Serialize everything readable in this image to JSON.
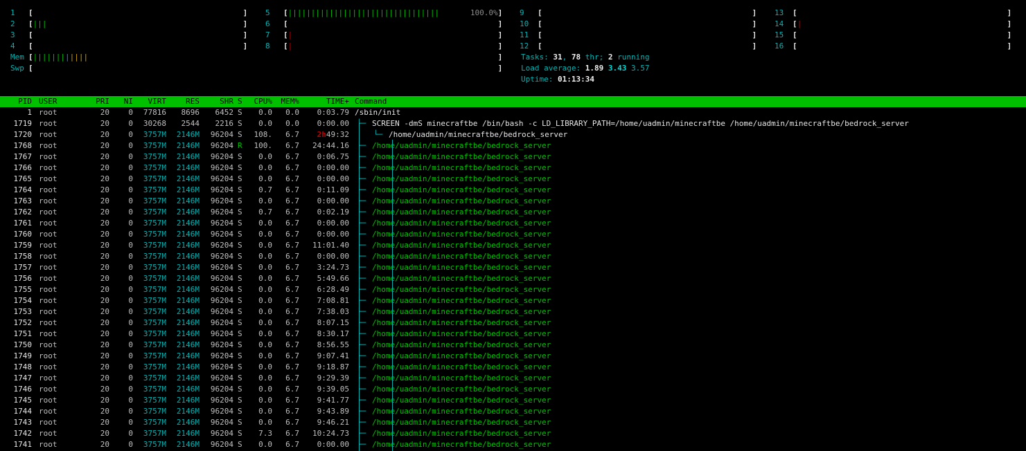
{
  "cpu_meters": [
    {
      "label": "1",
      "segments": []
    },
    {
      "label": "2",
      "segments": [
        {
          "c": "g",
          "t": "|||"
        }
      ]
    },
    {
      "label": "3",
      "segments": []
    },
    {
      "label": "4",
      "segments": []
    },
    {
      "label": "5",
      "segments": [
        {
          "c": "g",
          "t": "|||||||||||||||||||||||||||||||||"
        }
      ],
      "percent": "100.0%"
    },
    {
      "label": "6",
      "segments": []
    },
    {
      "label": "7",
      "segments": [
        {
          "c": "r",
          "t": "|"
        }
      ]
    },
    {
      "label": "8",
      "segments": [
        {
          "c": "r",
          "t": "|"
        }
      ]
    },
    {
      "label": "9",
      "segments": []
    },
    {
      "label": "10",
      "segments": []
    },
    {
      "label": "11",
      "segments": []
    },
    {
      "label": "12",
      "segments": []
    },
    {
      "label": "13",
      "segments": []
    },
    {
      "label": "14",
      "segments": [
        {
          "c": "r",
          "t": "|"
        }
      ]
    },
    {
      "label": "15",
      "segments": []
    },
    {
      "label": "16",
      "segments": []
    }
  ],
  "mem": {
    "label": "Mem",
    "segments": [
      {
        "c": "g",
        "t": "|||||||"
      },
      {
        "c": "b",
        "t": "|"
      },
      {
        "c": "y",
        "t": "||||"
      }
    ]
  },
  "swp": {
    "label": "Swp",
    "segments": []
  },
  "bracket_open": "[",
  "bracket_close": "]",
  "tasks": {
    "prefix": "Tasks: ",
    "tasks": "31",
    "sep": ", ",
    "threads": "78",
    "thr": " thr; ",
    "running": "2",
    "running_label": " running"
  },
  "load": {
    "prefix": "Load average: ",
    "l1": "1.89",
    "l5": "3.43",
    "l15": "3.57"
  },
  "uptime": {
    "prefix": "Uptime: ",
    "value": "01:13:34"
  },
  "columns": {
    "pid": "PID",
    "user": "USER",
    "pri": "PRI",
    "ni": "NI",
    "virt": "VIRT",
    "res": "RES",
    "shr": "SHR",
    "s": "S",
    "cpu": "CPU%",
    "mem": "MEM%",
    "time": "TIME+",
    "cmd": "Command"
  },
  "processes": [
    {
      "pid": "1",
      "user": "root",
      "pri": "20",
      "ni": "0",
      "virt": "77816",
      "res": "8696",
      "shr": "6452",
      "s": "S",
      "cpu": "0.0",
      "mem": "0.0",
      "time": "0:03.79",
      "tree": "",
      "cmd": "/sbin/init",
      "cmd_color": "w"
    },
    {
      "pid": "1719",
      "user": "root",
      "pri": "20",
      "ni": "0",
      "virt": "30268",
      "res": "2544",
      "shr": "2216",
      "s": "S",
      "cpu": "0.0",
      "mem": "0.0",
      "time": "0:00.00",
      "tree": "├─",
      "cmd": "SCREEN -dmS minecraftbe /bin/bash -c LD_LIBRARY_PATH=/home/uadmin/minecraftbe /home/uadmin/minecraftbe/bedrock_server",
      "cmd_color": "w"
    },
    {
      "pid": "1720",
      "user": "root",
      "pri": "20",
      "ni": "0",
      "virt": "3757M",
      "res": "2146M",
      "shr": "96204",
      "s": "S",
      "cpu": "108.",
      "mem": "6.7",
      "time_h": "2h",
      "time": "49:32",
      "tree": "└─",
      "cmd": "/home/uadmin/minecraftbe/bedrock_server",
      "cmd_color": "w"
    },
    {
      "pid": "1768",
      "user": "root",
      "pri": "20",
      "ni": "0",
      "virt": "3757M",
      "res": "2146M",
      "shr": "96204",
      "s": "R",
      "cpu": "100.",
      "mem": "6.7",
      "time": "24:44.16",
      "tree": "├─",
      "cmd": "/home/uadmin/minecraftbe/bedrock_server",
      "cmd_color": "g"
    },
    {
      "pid": "1767",
      "user": "root",
      "pri": "20",
      "ni": "0",
      "virt": "3757M",
      "res": "2146M",
      "shr": "96204",
      "s": "S",
      "cpu": "0.0",
      "mem": "6.7",
      "time": "0:06.75",
      "tree": "├─",
      "cmd": "/home/uadmin/minecraftbe/bedrock_server",
      "cmd_color": "g"
    },
    {
      "pid": "1766",
      "user": "root",
      "pri": "20",
      "ni": "0",
      "virt": "3757M",
      "res": "2146M",
      "shr": "96204",
      "s": "S",
      "cpu": "0.0",
      "mem": "6.7",
      "time": "0:00.00",
      "tree": "├─",
      "cmd": "/home/uadmin/minecraftbe/bedrock_server",
      "cmd_color": "g"
    },
    {
      "pid": "1765",
      "user": "root",
      "pri": "20",
      "ni": "0",
      "virt": "3757M",
      "res": "2146M",
      "shr": "96204",
      "s": "S",
      "cpu": "0.0",
      "mem": "6.7",
      "time": "0:00.00",
      "tree": "├─",
      "cmd": "/home/uadmin/minecraftbe/bedrock_server",
      "cmd_color": "g"
    },
    {
      "pid": "1764",
      "user": "root",
      "pri": "20",
      "ni": "0",
      "virt": "3757M",
      "res": "2146M",
      "shr": "96204",
      "s": "S",
      "cpu": "0.7",
      "mem": "6.7",
      "time": "0:11.09",
      "tree": "├─",
      "cmd": "/home/uadmin/minecraftbe/bedrock_server",
      "cmd_color": "g"
    },
    {
      "pid": "1763",
      "user": "root",
      "pri": "20",
      "ni": "0",
      "virt": "3757M",
      "res": "2146M",
      "shr": "96204",
      "s": "S",
      "cpu": "0.0",
      "mem": "6.7",
      "time": "0:00.00",
      "tree": "├─",
      "cmd": "/home/uadmin/minecraftbe/bedrock_server",
      "cmd_color": "g"
    },
    {
      "pid": "1762",
      "user": "root",
      "pri": "20",
      "ni": "0",
      "virt": "3757M",
      "res": "2146M",
      "shr": "96204",
      "s": "S",
      "cpu": "0.7",
      "mem": "6.7",
      "time": "0:02.19",
      "tree": "├─",
      "cmd": "/home/uadmin/minecraftbe/bedrock_server",
      "cmd_color": "g"
    },
    {
      "pid": "1761",
      "user": "root",
      "pri": "20",
      "ni": "0",
      "virt": "3757M",
      "res": "2146M",
      "shr": "96204",
      "s": "S",
      "cpu": "0.0",
      "mem": "6.7",
      "time": "0:00.00",
      "tree": "├─",
      "cmd": "/home/uadmin/minecraftbe/bedrock_server",
      "cmd_color": "g"
    },
    {
      "pid": "1760",
      "user": "root",
      "pri": "20",
      "ni": "0",
      "virt": "3757M",
      "res": "2146M",
      "shr": "96204",
      "s": "S",
      "cpu": "0.0",
      "mem": "6.7",
      "time": "0:00.00",
      "tree": "├─",
      "cmd": "/home/uadmin/minecraftbe/bedrock_server",
      "cmd_color": "g"
    },
    {
      "pid": "1759",
      "user": "root",
      "pri": "20",
      "ni": "0",
      "virt": "3757M",
      "res": "2146M",
      "shr": "96204",
      "s": "S",
      "cpu": "0.0",
      "mem": "6.7",
      "time": "11:01.40",
      "tree": "├─",
      "cmd": "/home/uadmin/minecraftbe/bedrock_server",
      "cmd_color": "g"
    },
    {
      "pid": "1758",
      "user": "root",
      "pri": "20",
      "ni": "0",
      "virt": "3757M",
      "res": "2146M",
      "shr": "96204",
      "s": "S",
      "cpu": "0.0",
      "mem": "6.7",
      "time": "0:00.00",
      "tree": "├─",
      "cmd": "/home/uadmin/minecraftbe/bedrock_server",
      "cmd_color": "g"
    },
    {
      "pid": "1757",
      "user": "root",
      "pri": "20",
      "ni": "0",
      "virt": "3757M",
      "res": "2146M",
      "shr": "96204",
      "s": "S",
      "cpu": "0.0",
      "mem": "6.7",
      "time": "3:24.73",
      "tree": "├─",
      "cmd": "/home/uadmin/minecraftbe/bedrock_server",
      "cmd_color": "g"
    },
    {
      "pid": "1756",
      "user": "root",
      "pri": "20",
      "ni": "0",
      "virt": "3757M",
      "res": "2146M",
      "shr": "96204",
      "s": "S",
      "cpu": "0.0",
      "mem": "6.7",
      "time": "5:49.66",
      "tree": "├─",
      "cmd": "/home/uadmin/minecraftbe/bedrock_server",
      "cmd_color": "g"
    },
    {
      "pid": "1755",
      "user": "root",
      "pri": "20",
      "ni": "0",
      "virt": "3757M",
      "res": "2146M",
      "shr": "96204",
      "s": "S",
      "cpu": "0.0",
      "mem": "6.7",
      "time": "6:28.49",
      "tree": "├─",
      "cmd": "/home/uadmin/minecraftbe/bedrock_server",
      "cmd_color": "g"
    },
    {
      "pid": "1754",
      "user": "root",
      "pri": "20",
      "ni": "0",
      "virt": "3757M",
      "res": "2146M",
      "shr": "96204",
      "s": "S",
      "cpu": "0.0",
      "mem": "6.7",
      "time": "7:08.81",
      "tree": "├─",
      "cmd": "/home/uadmin/minecraftbe/bedrock_server",
      "cmd_color": "g"
    },
    {
      "pid": "1753",
      "user": "root",
      "pri": "20",
      "ni": "0",
      "virt": "3757M",
      "res": "2146M",
      "shr": "96204",
      "s": "S",
      "cpu": "0.0",
      "mem": "6.7",
      "time": "7:38.03",
      "tree": "├─",
      "cmd": "/home/uadmin/minecraftbe/bedrock_server",
      "cmd_color": "g"
    },
    {
      "pid": "1752",
      "user": "root",
      "pri": "20",
      "ni": "0",
      "virt": "3757M",
      "res": "2146M",
      "shr": "96204",
      "s": "S",
      "cpu": "0.0",
      "mem": "6.7",
      "time": "8:07.15",
      "tree": "├─",
      "cmd": "/home/uadmin/minecraftbe/bedrock_server",
      "cmd_color": "g"
    },
    {
      "pid": "1751",
      "user": "root",
      "pri": "20",
      "ni": "0",
      "virt": "3757M",
      "res": "2146M",
      "shr": "96204",
      "s": "S",
      "cpu": "0.0",
      "mem": "6.7",
      "time": "8:30.17",
      "tree": "├─",
      "cmd": "/home/uadmin/minecraftbe/bedrock_server",
      "cmd_color": "g"
    },
    {
      "pid": "1750",
      "user": "root",
      "pri": "20",
      "ni": "0",
      "virt": "3757M",
      "res": "2146M",
      "shr": "96204",
      "s": "S",
      "cpu": "0.0",
      "mem": "6.7",
      "time": "8:56.55",
      "tree": "├─",
      "cmd": "/home/uadmin/minecraftbe/bedrock_server",
      "cmd_color": "g"
    },
    {
      "pid": "1749",
      "user": "root",
      "pri": "20",
      "ni": "0",
      "virt": "3757M",
      "res": "2146M",
      "shr": "96204",
      "s": "S",
      "cpu": "0.0",
      "mem": "6.7",
      "time": "9:07.41",
      "tree": "├─",
      "cmd": "/home/uadmin/minecraftbe/bedrock_server",
      "cmd_color": "g"
    },
    {
      "pid": "1748",
      "user": "root",
      "pri": "20",
      "ni": "0",
      "virt": "3757M",
      "res": "2146M",
      "shr": "96204",
      "s": "S",
      "cpu": "0.0",
      "mem": "6.7",
      "time": "9:18.87",
      "tree": "├─",
      "cmd": "/home/uadmin/minecraftbe/bedrock_server",
      "cmd_color": "g"
    },
    {
      "pid": "1747",
      "user": "root",
      "pri": "20",
      "ni": "0",
      "virt": "3757M",
      "res": "2146M",
      "shr": "96204",
      "s": "S",
      "cpu": "0.0",
      "mem": "6.7",
      "time": "9:29.39",
      "tree": "├─",
      "cmd": "/home/uadmin/minecraftbe/bedrock_server",
      "cmd_color": "g"
    },
    {
      "pid": "1746",
      "user": "root",
      "pri": "20",
      "ni": "0",
      "virt": "3757M",
      "res": "2146M",
      "shr": "96204",
      "s": "S",
      "cpu": "0.0",
      "mem": "6.7",
      "time": "9:39.05",
      "tree": "├─",
      "cmd": "/home/uadmin/minecraftbe/bedrock_server",
      "cmd_color": "g"
    },
    {
      "pid": "1745",
      "user": "root",
      "pri": "20",
      "ni": "0",
      "virt": "3757M",
      "res": "2146M",
      "shr": "96204",
      "s": "S",
      "cpu": "0.0",
      "mem": "6.7",
      "time": "9:41.77",
      "tree": "├─",
      "cmd": "/home/uadmin/minecraftbe/bedrock_server",
      "cmd_color": "g"
    },
    {
      "pid": "1744",
      "user": "root",
      "pri": "20",
      "ni": "0",
      "virt": "3757M",
      "res": "2146M",
      "shr": "96204",
      "s": "S",
      "cpu": "0.0",
      "mem": "6.7",
      "time": "9:43.89",
      "tree": "├─",
      "cmd": "/home/uadmin/minecraftbe/bedrock_server",
      "cmd_color": "g"
    },
    {
      "pid": "1743",
      "user": "root",
      "pri": "20",
      "ni": "0",
      "virt": "3757M",
      "res": "2146M",
      "shr": "96204",
      "s": "S",
      "cpu": "0.0",
      "mem": "6.7",
      "time": "9:46.21",
      "tree": "├─",
      "cmd": "/home/uadmin/minecraftbe/bedrock_server",
      "cmd_color": "g"
    },
    {
      "pid": "1742",
      "user": "root",
      "pri": "20",
      "ni": "0",
      "virt": "3757M",
      "res": "2146M",
      "shr": "96204",
      "s": "S",
      "cpu": "7.3",
      "mem": "6.7",
      "time": "10:24.73",
      "tree": "├─",
      "cmd": "/home/uadmin/minecraftbe/bedrock_server",
      "cmd_color": "g"
    },
    {
      "pid": "1741",
      "user": "root",
      "pri": "20",
      "ni": "0",
      "virt": "3757M",
      "res": "2146M",
      "shr": "96204",
      "s": "S",
      "cpu": "0.0",
      "mem": "6.7",
      "time": "0:00.00",
      "tree": "├─",
      "cmd": "/home/uadmin/minecraftbe/bedrock_server",
      "cmd_color": "g"
    }
  ],
  "colors": {
    "header_bg": "#00c000",
    "cyan": "#00b4b4",
    "green": "#00c000",
    "red": "#c00000"
  }
}
